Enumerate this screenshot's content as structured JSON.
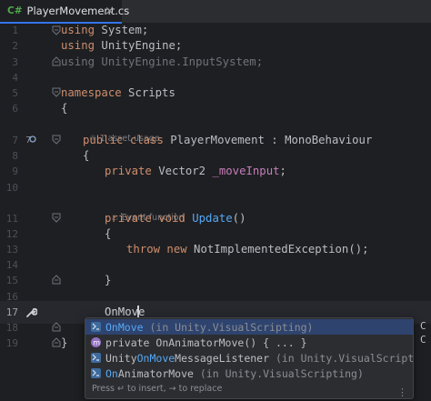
{
  "tab": {
    "lang": "C#",
    "file_name": "PlayerMovement.cs",
    "close": "×"
  },
  "line_numbers": [
    "1",
    "2",
    "3",
    "4",
    "5",
    "6",
    "7",
    "8",
    "9",
    "10",
    "11",
    "12",
    "13",
    "14",
    "15",
    "16",
    "17",
    "18",
    "19"
  ],
  "code": {
    "l1": {
      "kw": "using",
      "rest": " System;"
    },
    "l2": {
      "kw": "using",
      "rest": " UnityEngine;"
    },
    "l3": {
      "text": "using UnityEngine.InputSystem;"
    },
    "l5": {
      "kw": "namespace",
      "rest": " Scripts"
    },
    "l6": "{",
    "hint_asset_usage": "1 asset usage",
    "l7": {
      "kw1": "public",
      "kw2": " class ",
      "name": "PlayerMovement",
      "sep": " : ",
      "base": "MonoBehaviour"
    },
    "l8": "{",
    "l9": {
      "kw": "private",
      "type": " Vector2 ",
      "field": "_moveInput",
      "end": ";"
    },
    "hint_event_function": "Event function",
    "l11": {
      "kw": "private void ",
      "name": "Update",
      "end": "()"
    },
    "l12": "{",
    "l13": {
      "kw": "throw new ",
      "type": "NotImplementedException",
      "end": "();"
    },
    "l15": "}",
    "l17": "OnMove",
    "l19": "}"
  },
  "completion": {
    "items": [
      {
        "highlight": "OnMove",
        "rest": "",
        "detail": " (in Unity.VisualScripting)",
        "icon": "class-icon"
      },
      {
        "prefix": "private ",
        "highlight": "",
        "rest": "OnAnimatorMove() { ... }",
        "detail": "",
        "icon": "method-icon"
      },
      {
        "prefix": "Unity",
        "highlight": "OnMove",
        "rest": "MessageListener",
        "detail": " (in Unity.VisualScripting)",
        "icon": "class-icon"
      },
      {
        "highlight": "On",
        "rest": "AnimatorMove",
        "detail": " (in Unity.VisualScripting)",
        "icon": "class-icon"
      }
    ],
    "footer": "Press ↵ to insert, → to replace",
    "more": "⋮"
  },
  "side_letters": [
    "C",
    "C"
  ]
}
